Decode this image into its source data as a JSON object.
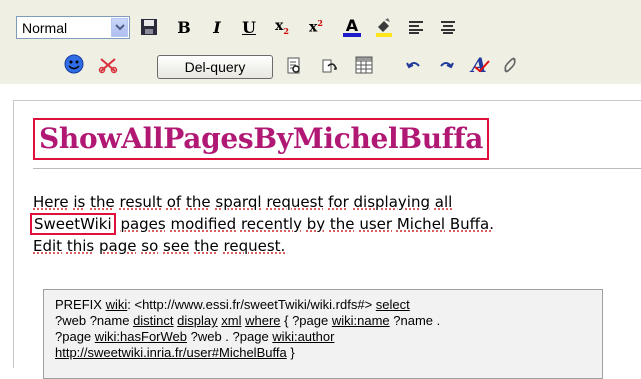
{
  "toolbar": {
    "style_select": {
      "value": "Normal"
    },
    "del_query_label": "Del-query",
    "icons": {
      "save": "save-icon",
      "bold": "B",
      "italic": "I",
      "underline": "U",
      "subscript": "x",
      "superscript": "x",
      "font_color": "A",
      "highlight": "highlight-icon",
      "align_left": "align-left-icon",
      "align_center": "align-center-icon",
      "smiley": "smiley-icon",
      "cut": "scissors-icon",
      "undo": "undo-icon",
      "redo": "redo-icon",
      "spellcheck": "A",
      "link": "link-icon",
      "table": "table-icon"
    },
    "colors": {
      "background": "#efefe4",
      "font_color_bar": "#1c1ccc",
      "highlight_bar": "#ffe41c"
    }
  },
  "page": {
    "title": "ShowAllPagesByMichelBuffa",
    "title_color": "#b01874",
    "intro": {
      "l1_a": "Here",
      "l1_b": "is",
      "l1_c": "the",
      "l1_d": "result",
      "l1_e": "of",
      "l1_f": "the",
      "l1_g": "sparql",
      "l1_h": "request",
      "l1_i": "for",
      "l1_j": "displaying",
      "l1_k": "all",
      "l2_a": "SweetWiki",
      "l2_b": "pages",
      "l2_c": "modified",
      "l2_d": "recently",
      "l2_e": "by",
      "l2_f": "the",
      "l2_g": "user",
      "l2_h": "Michel",
      "l2_i": "Buffa.",
      "l3_a": "Edit",
      "l3_b": "this",
      "l3_c": "page",
      "l3_d": "so",
      "l3_e": "see",
      "l3_f": "the",
      "l3_g": "request."
    },
    "code": {
      "l1_a": "PREFIX ",
      "l1_b": "wiki",
      "l1_c": ": <http://www.essi.fr/sweetTwiki/wiki.rdfs#> ",
      "l1_d": "select",
      "l2_a": "?web ?name ",
      "l2_b": "distinct",
      "l2_c": " ",
      "l2_d": "display",
      "l2_e": " ",
      "l2_f": "xml",
      "l2_g": " ",
      "l2_h": "where",
      "l2_i": " { ?page ",
      "l2_j": "wiki:name",
      "l2_k": " ?name .",
      "l3_a": "?page ",
      "l3_b": "wiki:hasForWeb",
      "l3_c": " ?web . ?page ",
      "l3_d": "wiki:author",
      "l4_a": "http://sweetwiki.inria.fr/user#MichelBuffa",
      "l4_b": " }"
    }
  }
}
